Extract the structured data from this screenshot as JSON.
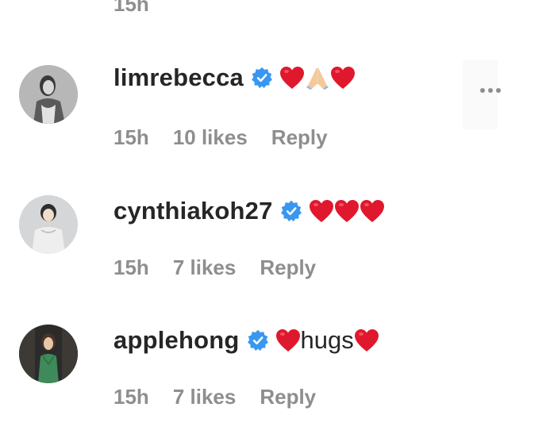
{
  "top_partial": {
    "time": "15h"
  },
  "comments": [
    {
      "username": "limrebecca",
      "verified": true,
      "content": [
        "heart",
        "folded-hands",
        "heart"
      ],
      "text": "",
      "time": "15h",
      "likes": "10 likes",
      "reply": "Reply",
      "has_more_menu": true
    },
    {
      "username": "cynthiakoh27",
      "verified": true,
      "content": [
        "heart",
        "heart",
        "heart"
      ],
      "text": "",
      "time": "15h",
      "likes": "7 likes",
      "reply": "Reply",
      "has_more_menu": false
    },
    {
      "username": "applehong",
      "verified": true,
      "content": [
        "heart",
        "text",
        "heart"
      ],
      "text": "hugs",
      "time": "15h",
      "likes": "7 likes",
      "reply": "Reply",
      "has_more_menu": false
    }
  ],
  "icons": {
    "verified": "verified-badge-icon",
    "heart": "red-heart-icon",
    "hands": "folded-hands-icon",
    "more": "more-options-icon"
  },
  "colors": {
    "primary_text": "#262626",
    "secondary_text": "#8e8e8e",
    "verified_blue": "#3897f0",
    "heart_red": "#e0182d"
  }
}
